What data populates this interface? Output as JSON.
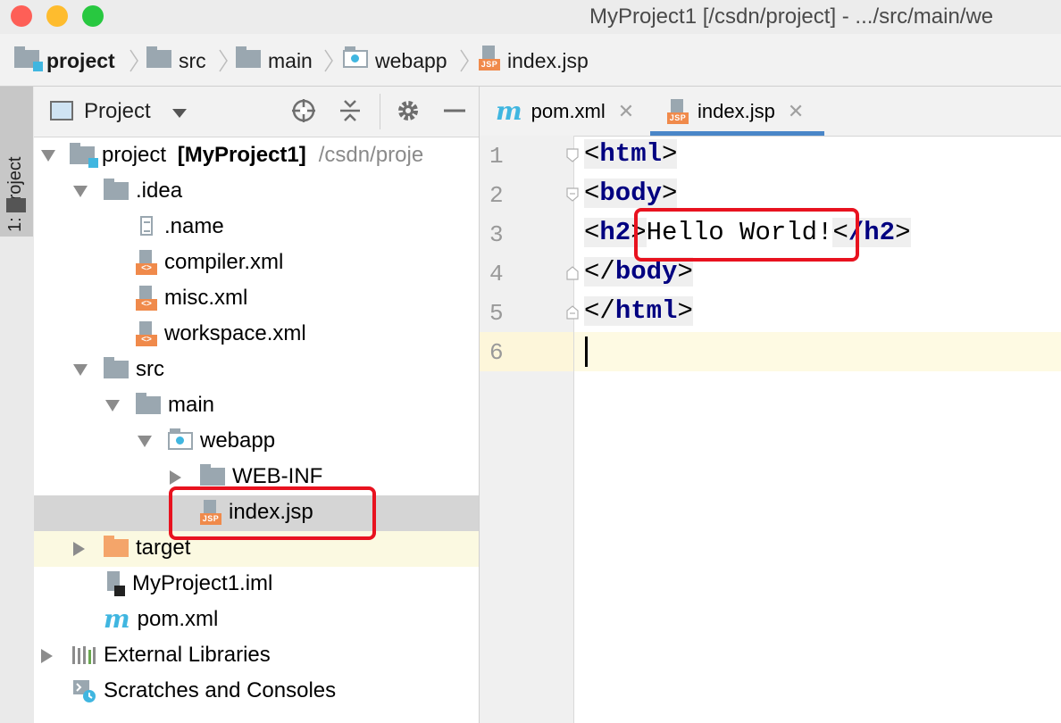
{
  "window": {
    "title": "MyProject1 [/csdn/project] - .../src/main/we",
    "traffic_lights": {
      "close": "#fe5f57",
      "minimize": "#febc2e",
      "zoom": "#28c840"
    }
  },
  "breadcrumb": [
    {
      "label": "project",
      "icon": "module-folder-icon",
      "bold": true
    },
    {
      "label": "src",
      "icon": "folder-icon"
    },
    {
      "label": "main",
      "icon": "folder-icon"
    },
    {
      "label": "webapp",
      "icon": "web-folder-icon"
    },
    {
      "label": "index.jsp",
      "icon": "jsp-file-icon"
    }
  ],
  "stripe": {
    "label": "1: Project"
  },
  "panel": {
    "title": "Project"
  },
  "tree": {
    "project_name": "project",
    "project_module": "[MyProject1]",
    "project_path": "/csdn/proje",
    "idea": ".idea",
    "name_file": ".name",
    "compiler": "compiler.xml",
    "misc": "misc.xml",
    "workspace": "workspace.xml",
    "src": "src",
    "main": "main",
    "webapp": "webapp",
    "webinf": "WEB-INF",
    "indexjsp": "index.jsp",
    "target": "target",
    "iml": "MyProject1.iml",
    "pom": "pom.xml",
    "extlibs": "External Libraries",
    "scratches": "Scratches and Consoles"
  },
  "editor": {
    "tabs": [
      {
        "label": "pom.xml",
        "icon": "maven-icon",
        "active": false
      },
      {
        "label": "index.jsp",
        "icon": "jsp-file-icon",
        "active": true
      }
    ],
    "line_numbers": [
      "1",
      "2",
      "3",
      "4",
      "5",
      "6"
    ],
    "code": {
      "l1": {
        "open": "<",
        "tag": "html",
        "close": ">"
      },
      "l2": {
        "open": "<",
        "tag": "body",
        "close": ">"
      },
      "l3": {
        "open": "<",
        "tag": "h2",
        "mid": ">",
        "text": "Hello World!",
        "open2": "<",
        "tag2": "/h2",
        "close": ">"
      },
      "l4": {
        "open": "</",
        "tag": "body",
        "close": ">"
      },
      "l5": {
        "open": "</",
        "tag": "html",
        "close": ">"
      }
    },
    "highlight_color": "#e8121f",
    "tag_color": "#000080"
  }
}
